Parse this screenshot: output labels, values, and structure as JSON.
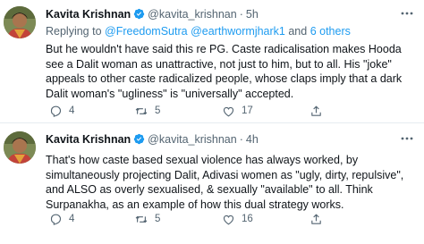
{
  "tweets": [
    {
      "author_name": "Kavita Krishnan",
      "handle": "@kavita_krishnan",
      "separator": "·",
      "time": "5h",
      "reply_prefix": "Replying to ",
      "reply_user1": "@FreedomSutra",
      "reply_mid": " ",
      "reply_user2": "@earthwormjhark1",
      "reply_and": " and ",
      "reply_others": "6 others",
      "text": "But he wouldn't have said this   re PG. Caste radicalisation makes Hooda see a Dalit woman as unattractive, not just to him, but to all. His \"joke\" appeals to other caste radicalized people, whose claps imply that a dark Dalit woman's \"ugliness\" is \"universally\" accepted.",
      "replies": "4",
      "retweets": "5",
      "likes": "17"
    },
    {
      "author_name": "Kavita Krishnan",
      "handle": "@kavita_krishnan",
      "separator": "·",
      "time": "4h",
      "text": "That's how caste based sexual violence has always worked, by simultaneously projecting Dalit, Adivasi women as \"ugly, dirty, repulsive\", and ALSO as overly sexualised, & sexually \"available\" to all. Think Surpanakha, as an example of how this dual strategy works.",
      "replies": "4",
      "retweets": "5",
      "likes": "16"
    }
  ],
  "icons": {
    "more": "more-horizontal-icon",
    "verified": "verified-badge-icon",
    "reply": "reply-icon",
    "retweet": "retweet-icon",
    "like": "like-icon",
    "share": "share-icon"
  },
  "colors": {
    "accent": "#1d9bf0",
    "secondary_text": "#536471",
    "divider": "#e6ecf0"
  }
}
